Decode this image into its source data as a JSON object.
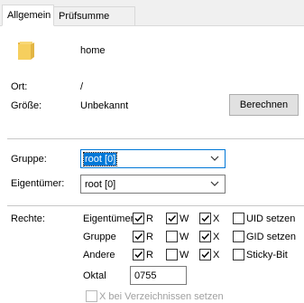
{
  "tabs": [
    {
      "label": "Allgemein",
      "active": true
    },
    {
      "label": "Prüfsumme",
      "active": false
    }
  ],
  "general": {
    "icon": "folder-icon",
    "name": "home",
    "location_label": "Ort:",
    "location_value": "/",
    "size_label": "Größe:",
    "size_value": "Unbekannt",
    "calculate_button": "Berechnen"
  },
  "owner": {
    "group_label": "Gruppe:",
    "group_value": "root [0]",
    "owner_label": "Eigentümer:",
    "owner_value": "root [0]"
  },
  "permissions": {
    "label": "Rechte:",
    "rows": [
      {
        "label": "Eigentümer",
        "r": true,
        "w": true,
        "x": true,
        "special_label": "UID setzen",
        "special": false
      },
      {
        "label": "Gruppe",
        "r": true,
        "w": false,
        "x": true,
        "special_label": "GID setzen",
        "special": false
      },
      {
        "label": "Andere",
        "r": true,
        "w": false,
        "x": true,
        "special_label": "Sticky-Bit",
        "special": false
      }
    ],
    "r_label": "R",
    "w_label": "W",
    "x_label": "X",
    "octal_label": "Oktal",
    "octal_value": "0755",
    "recursive_label": "X bei Verzeichnissen setzen"
  },
  "colors": {
    "accent": "#0078d7",
    "folder": "#f8d775"
  }
}
